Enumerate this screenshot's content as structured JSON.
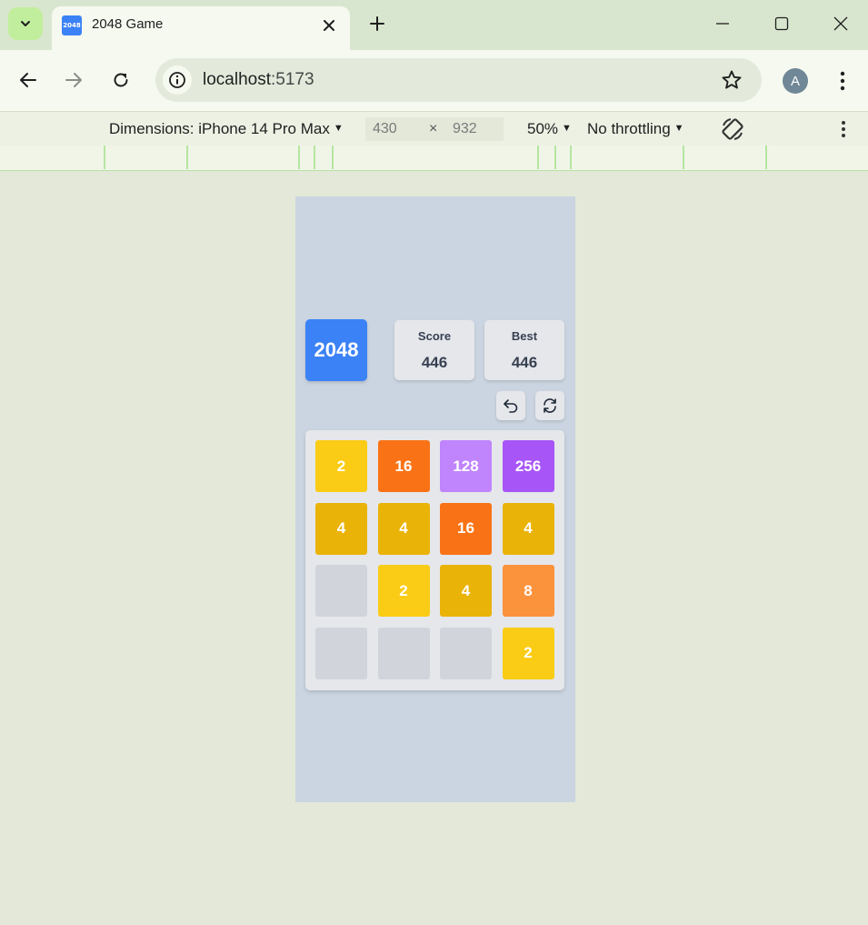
{
  "browser": {
    "tab_title": "2048 Game",
    "favicon_text": "2048",
    "url_host": "localhost",
    "url_port": ":5173",
    "profile_initial": "A"
  },
  "device_toolbar": {
    "dimensions_label": "Dimensions: iPhone 14 Pro Max",
    "width": "430",
    "height": "932",
    "times": "×",
    "zoom": "50%",
    "throttling": "No throttling"
  },
  "game": {
    "logo": "2048",
    "score_label": "Score",
    "score_value": "446",
    "best_label": "Best",
    "best_value": "446",
    "board": [
      [
        2,
        16,
        128,
        256
      ],
      [
        4,
        4,
        16,
        4
      ],
      [
        null,
        2,
        4,
        8
      ],
      [
        null,
        null,
        null,
        2
      ]
    ],
    "tile_colors": {
      "2": "#facc15",
      "4": "#eab308",
      "8": "#fb923c",
      "16": "#f97316",
      "128": "#c084fc",
      "256": "#a855f7",
      "empty": "#d1d5db"
    }
  }
}
